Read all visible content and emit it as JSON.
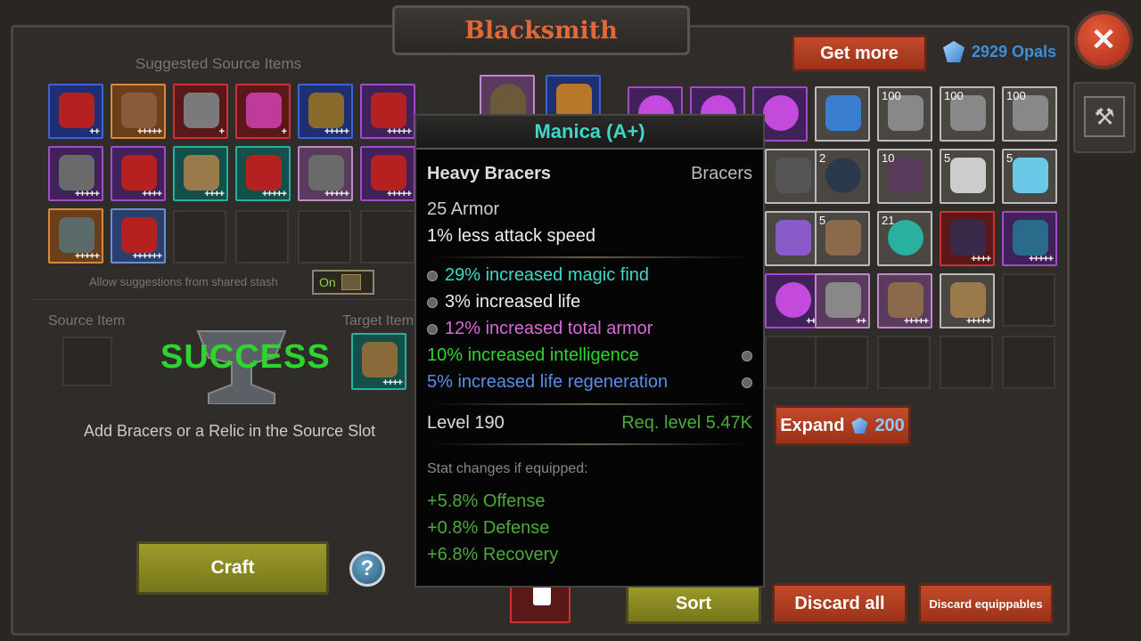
{
  "window": {
    "title": "Blacksmith"
  },
  "currency": {
    "get_more_label": "Get more",
    "opals_text": "2929 Opals"
  },
  "left_panel": {
    "suggested_label": "Suggested Source Items",
    "shared_stash_label": "Allow suggestions from shared stash",
    "toggle_label": "On",
    "source_item_label": "Source Item",
    "target_item_label": "Target Item",
    "success_text": "SUCCESS",
    "hint_text": "Add Bracers or a Relic in the Source Slot",
    "craft_label": "Craft",
    "help_label": "?"
  },
  "suggested_items": [
    {
      "rarity": "blue",
      "plus": "++"
    },
    {
      "rarity": "orange",
      "plus": "+++++"
    },
    {
      "rarity": "red",
      "plus": "+"
    },
    {
      "rarity": "red",
      "plus": "+"
    },
    {
      "rarity": "blue",
      "plus": "+++++"
    },
    {
      "rarity": "purple",
      "plus": "+++++"
    },
    {
      "rarity": "purple",
      "plus": "+++++"
    },
    {
      "rarity": "purple",
      "plus": "++++"
    },
    {
      "rarity": "teal",
      "plus": "++++"
    },
    {
      "rarity": "teal",
      "plus": "+++++"
    },
    {
      "rarity": "pink",
      "plus": "+++++"
    },
    {
      "rarity": "purple",
      "plus": "+++++"
    },
    {
      "rarity": "orange",
      "plus": "+++++"
    },
    {
      "rarity": "lblue",
      "plus": "++++++"
    }
  ],
  "tooltip": {
    "name": "Manica (A+)",
    "base_type": "Heavy Bracers",
    "slot_type": "Bracers",
    "armor": "25 Armor",
    "implicit": "1% less attack speed",
    "affixes": [
      {
        "text": "29% increased magic find",
        "color": "#3fd8c8"
      },
      {
        "text": "3% increased life",
        "color": "#eeeeee"
      },
      {
        "text": "12% increased total armor",
        "color": "#d86ad8"
      },
      {
        "text": "10% increased intelligence",
        "color": "#2fd52f"
      },
      {
        "text": "5% increased life regeneration",
        "color": "#5a8fe8"
      }
    ],
    "level": "Level 190",
    "req_level": "Req. level 5.47K",
    "stat_changes_label": "Stat changes if equipped:",
    "stat_changes": [
      "+5.8% Offense",
      "+0.8% Defense",
      "+6.8% Recovery"
    ]
  },
  "inventory": {
    "counts": [
      "100",
      "100",
      "100",
      "2",
      "10",
      "5",
      "5",
      "5",
      "21"
    ],
    "expand_label": "Expand",
    "expand_cost": "200",
    "sort_label": "Sort",
    "discard_all_label": "Discard all",
    "discard_equippables_label": "Discard equippables"
  },
  "colors": {
    "accent": "#e0683a",
    "success": "#2fd52f",
    "opal": "#3c8fd8"
  }
}
